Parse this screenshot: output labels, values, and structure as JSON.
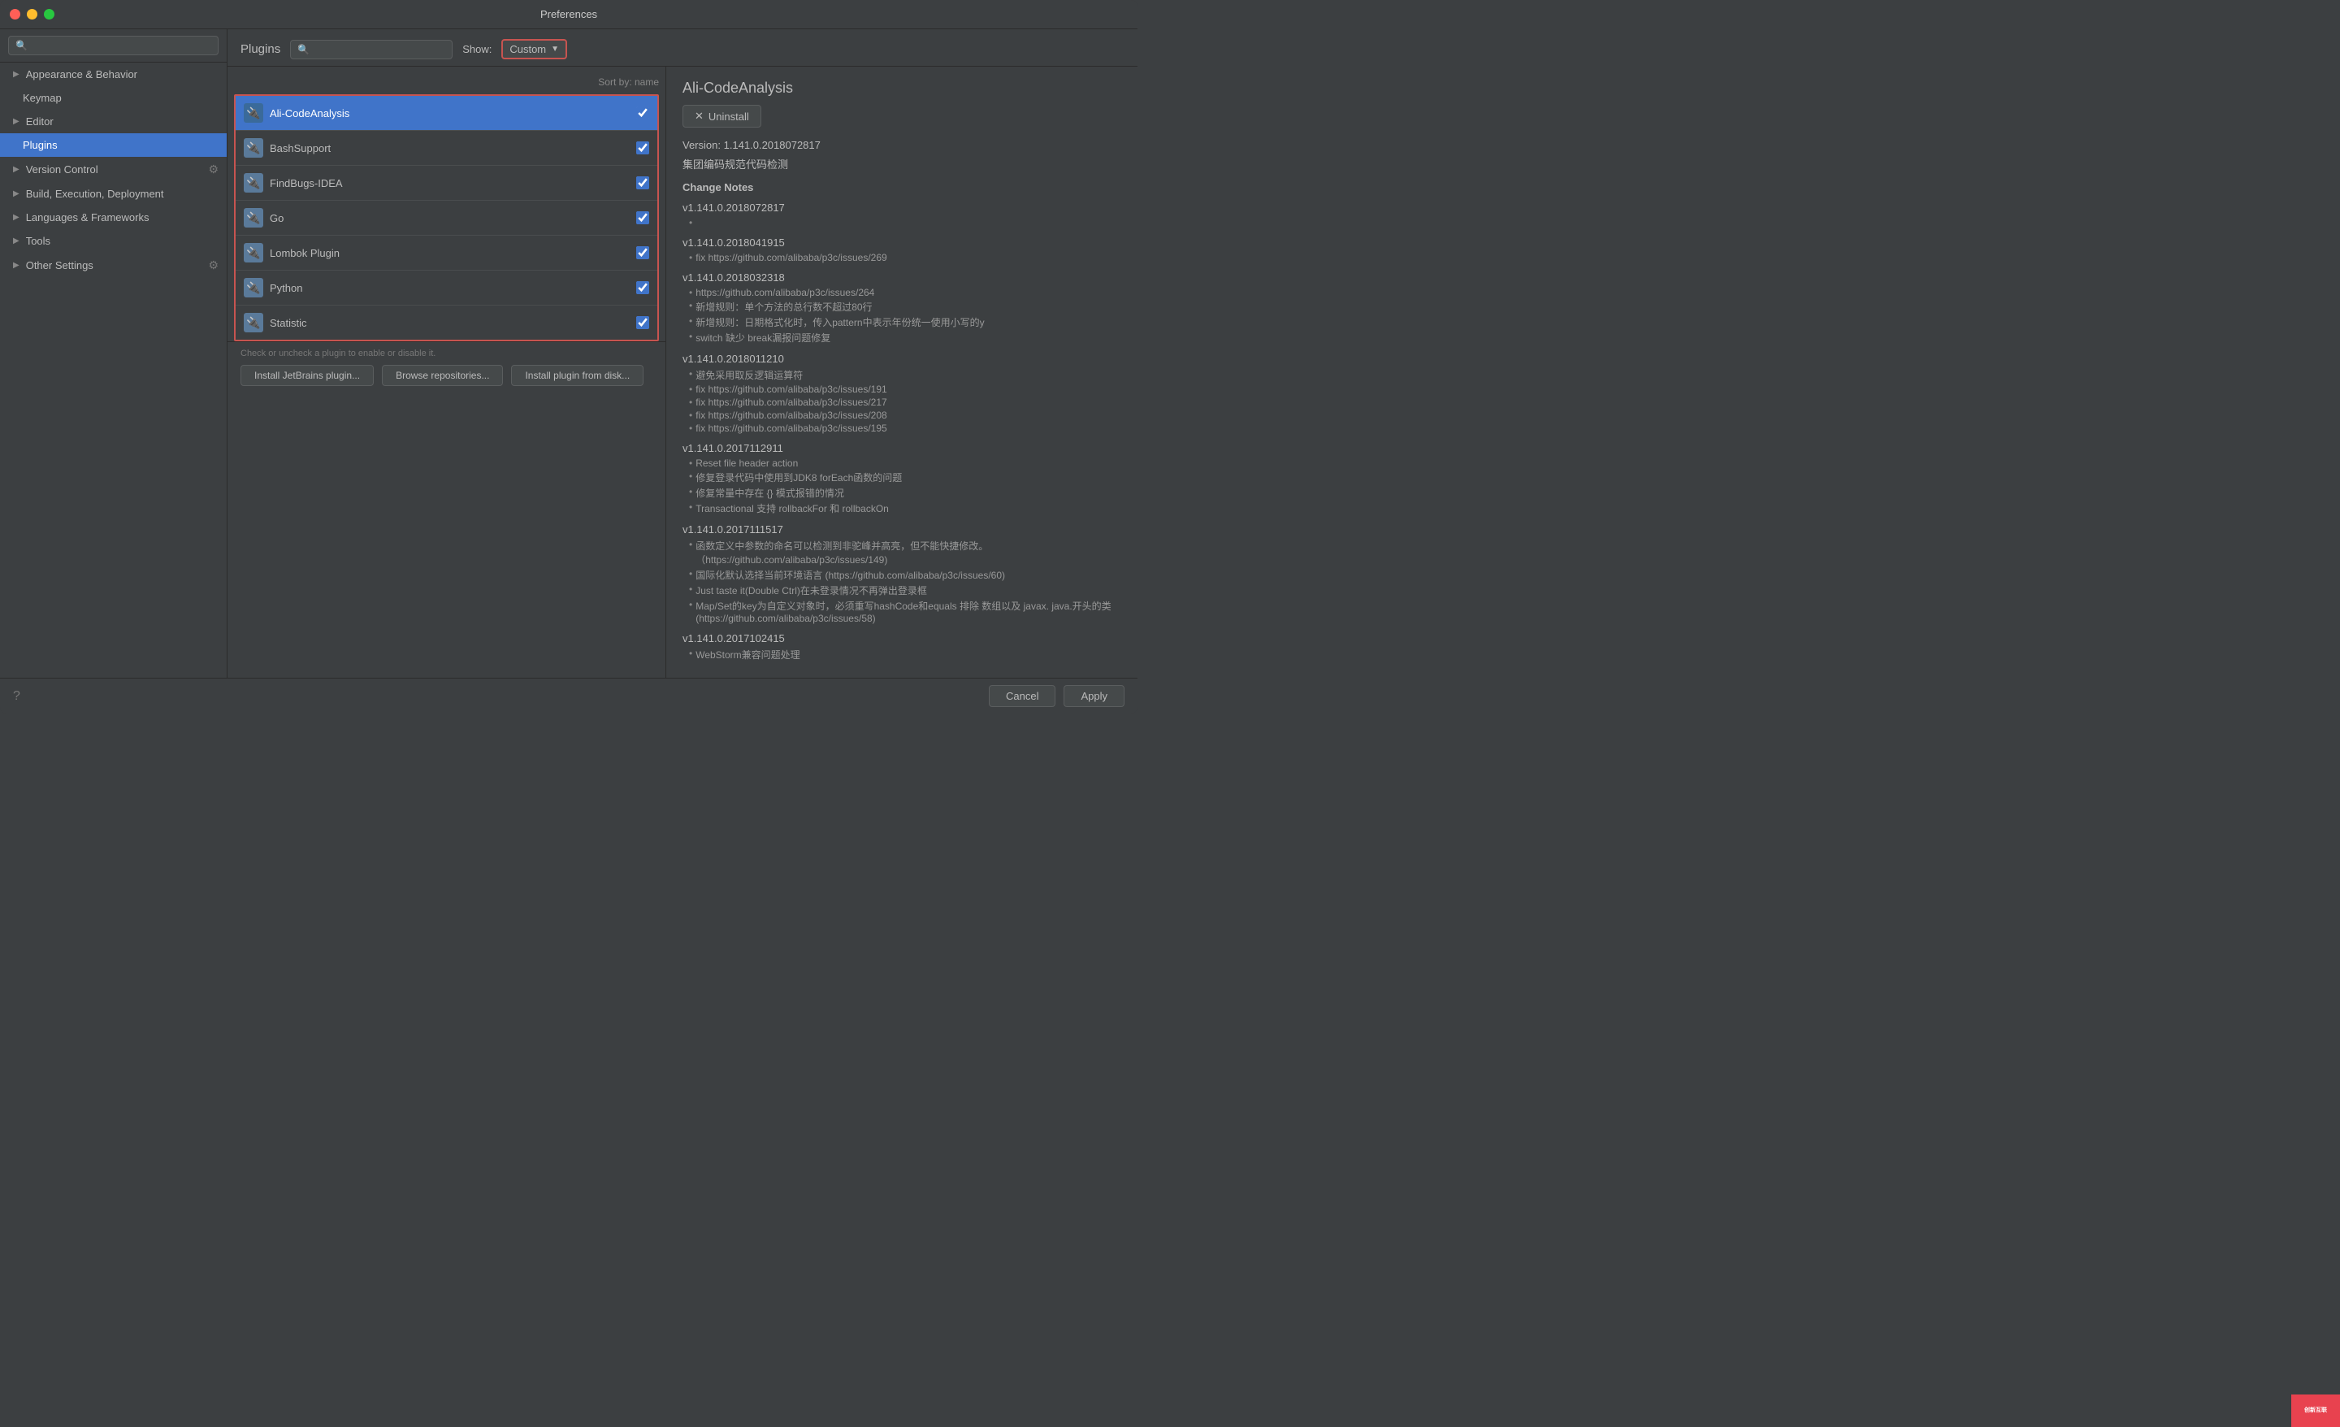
{
  "window": {
    "title": "Preferences"
  },
  "sidebar": {
    "search_placeholder": "🔍",
    "items": [
      {
        "id": "appearance-behavior",
        "label": "Appearance & Behavior",
        "indent": 0,
        "has_arrow": true,
        "active": false
      },
      {
        "id": "keymap",
        "label": "Keymap",
        "indent": 1,
        "has_arrow": false,
        "active": false
      },
      {
        "id": "editor",
        "label": "Editor",
        "indent": 0,
        "has_arrow": true,
        "active": false
      },
      {
        "id": "plugins",
        "label": "Plugins",
        "indent": 1,
        "has_arrow": false,
        "active": true
      },
      {
        "id": "version-control",
        "label": "Version Control",
        "indent": 0,
        "has_arrow": true,
        "active": false
      },
      {
        "id": "build-execution",
        "label": "Build, Execution, Deployment",
        "indent": 0,
        "has_arrow": true,
        "active": false
      },
      {
        "id": "languages",
        "label": "Languages & Frameworks",
        "indent": 0,
        "has_arrow": true,
        "active": false
      },
      {
        "id": "tools",
        "label": "Tools",
        "indent": 0,
        "has_arrow": true,
        "active": false
      },
      {
        "id": "other-settings",
        "label": "Other Settings",
        "indent": 0,
        "has_arrow": true,
        "active": false
      }
    ]
  },
  "plugins": {
    "title": "Plugins",
    "search_placeholder": "🔍",
    "show_label": "Show:",
    "dropdown_label": "Custom",
    "sort_label": "Sort by: name",
    "items": [
      {
        "id": "ali-codeanalysis",
        "name": "Ali-CodeAnalysis",
        "checked": true,
        "active": true
      },
      {
        "id": "bashsupport",
        "name": "BashSupport",
        "checked": true,
        "active": false
      },
      {
        "id": "findbugs-idea",
        "name": "FindBugs-IDEA",
        "checked": true,
        "active": false
      },
      {
        "id": "go",
        "name": "Go",
        "checked": true,
        "active": false
      },
      {
        "id": "lombok-plugin",
        "name": "Lombok Plugin",
        "checked": true,
        "active": false
      },
      {
        "id": "python",
        "name": "Python",
        "checked": true,
        "active": false
      },
      {
        "id": "statistic",
        "name": "Statistic",
        "checked": true,
        "active": false
      }
    ],
    "footer_note": "Check or uncheck a plugin to enable or disable it.",
    "btn_install": "Install JetBrains plugin...",
    "btn_browse": "Browse repositories...",
    "btn_from_disk": "Install plugin from disk..."
  },
  "detail": {
    "title": "Ali-CodeAnalysis",
    "uninstall_label": "Uninstall",
    "version": "Version: 1.141.0.2018072817",
    "description": "集团编码规范代码检测",
    "change_notes_title": "Change Notes",
    "versions": [
      {
        "version": "v1.141.0.2018072817",
        "notes": []
      },
      {
        "version": "v1.141.0.2018041915",
        "notes": [
          "fix https://github.com/alibaba/p3c/issues/269"
        ]
      },
      {
        "version": "v1.141.0.2018032318",
        "notes": [
          "https://github.com/alibaba/p3c/issues/264",
          "新增规则：单个方法的总行数不超过80行",
          "新增规则：日期格式化时，传入pattern中表示年份统一使用小写的y",
          "switch 缺少 break漏报问题修复"
        ]
      },
      {
        "version": "v1.141.0.2018011210",
        "notes": [
          "避免采用取反逻辑运算符",
          "fix https://github.com/alibaba/p3c/issues/191",
          "fix https://github.com/alibaba/p3c/issues/217",
          "fix https://github.com/alibaba/p3c/issues/208",
          "fix https://github.com/alibaba/p3c/issues/195"
        ]
      },
      {
        "version": "v1.141.0.2017112911",
        "notes": [
          "Reset file header action",
          "修复登录代码中使用到JDK8 forEach函数的问题",
          "修复常量中存在 {} 模式报错的情况",
          "Transactional 支持 rollbackFor 和 rollbackOn"
        ]
      },
      {
        "version": "v1.141.0.2017111517",
        "notes": [
          "函数定义中参数的命名可以检测到非驼峰并高亮，但不能快捷修改。（https://github.com/alibaba/p3c/issues/149)",
          "国际化默认选择当前环境语言 (https://github.com/alibaba/p3c/issues/60)",
          "Just taste it(Double Ctrl)在未登录情况不再弹出登录框",
          "Map/Set的key为自定义对象时，必须重写hashCode和equals 排除 数组以及 javax. java.开头的类 (https://github.com/alibaba/p3c/issues/58)"
        ]
      },
      {
        "version": "v1.141.0.2017102415",
        "notes": [
          "WebStorm兼容问题处理"
        ]
      }
    ]
  },
  "bottom": {
    "cancel_label": "Cancel",
    "apply_label": "Apply"
  }
}
